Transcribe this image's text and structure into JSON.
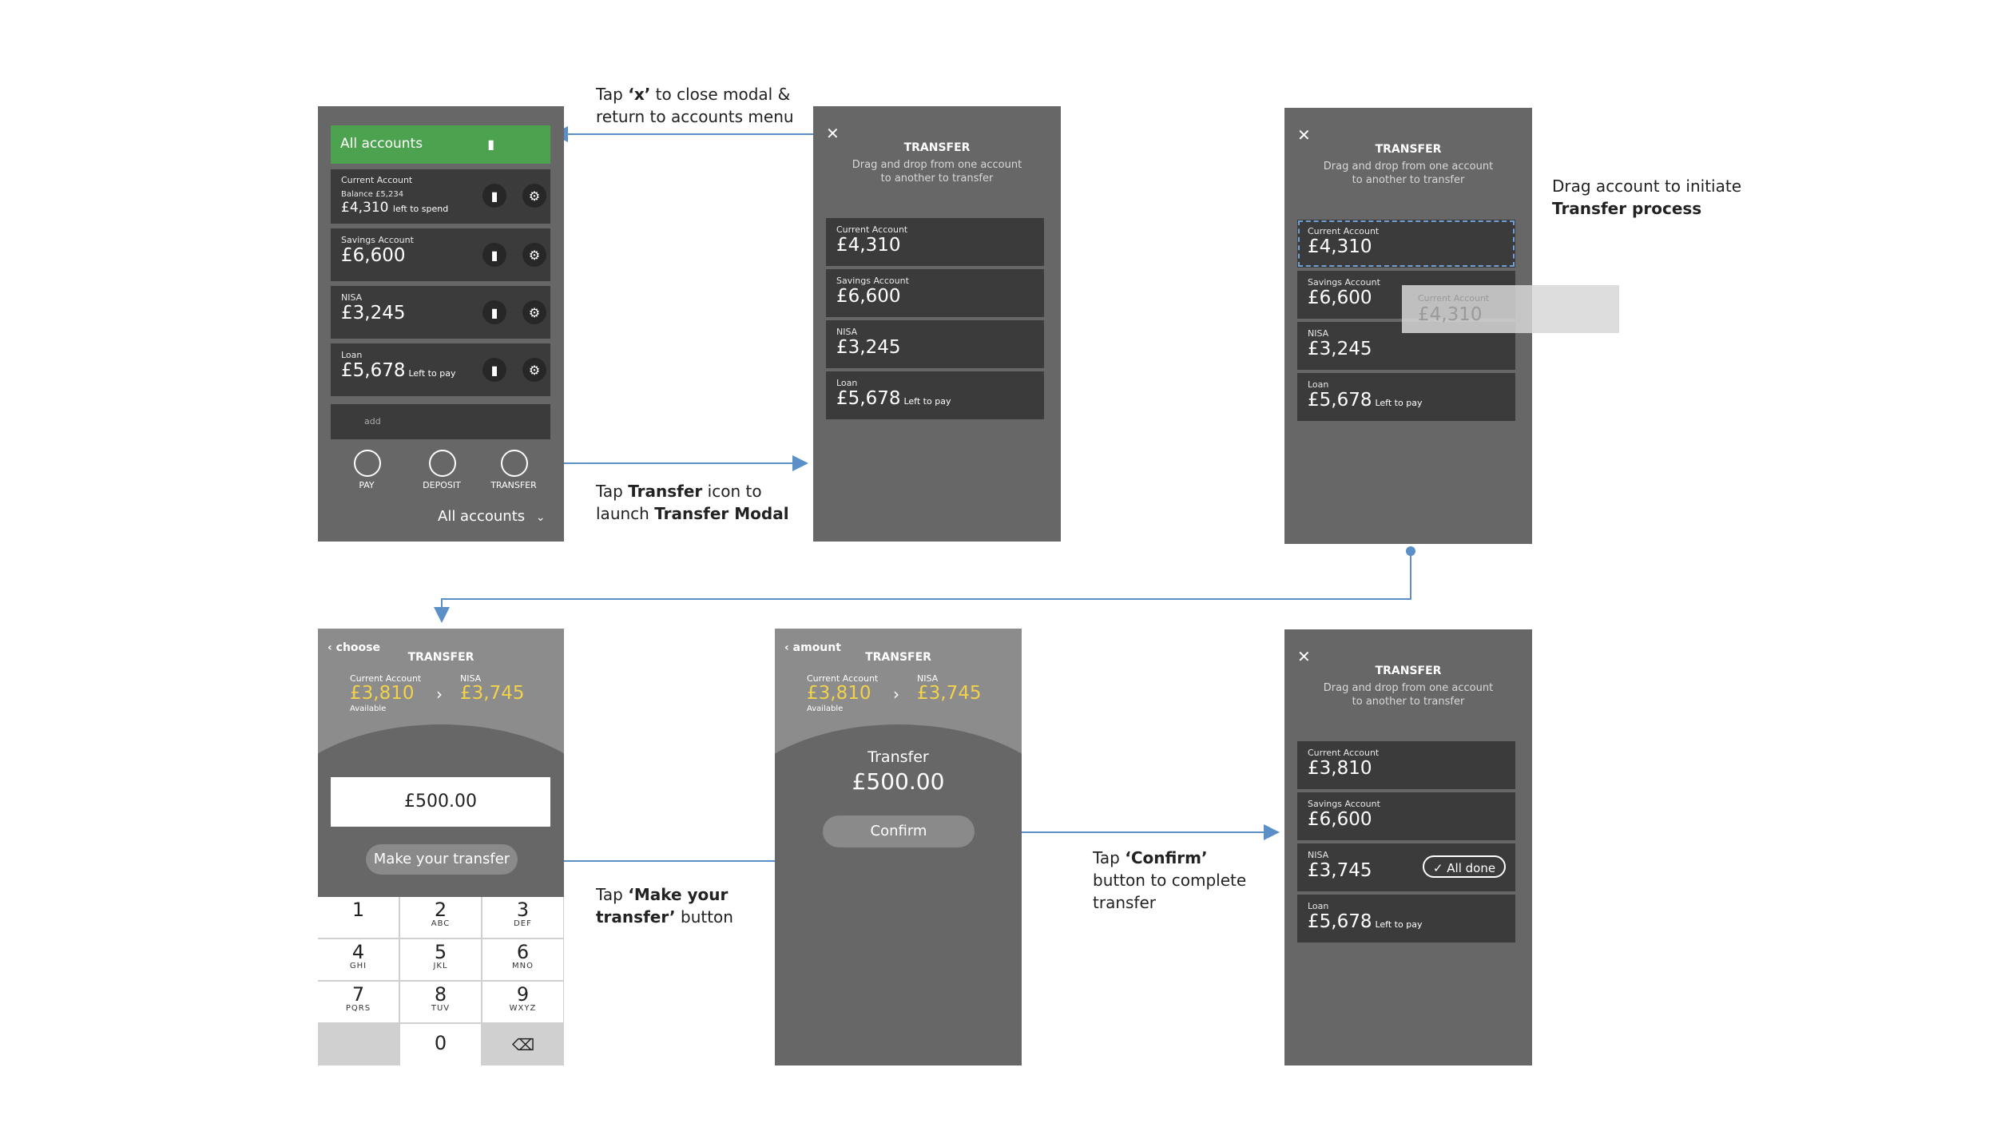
{
  "colors": {
    "screen": "#676767",
    "row": "#3b3b3b",
    "green": "#4da24f",
    "yellow": "#f2d24b",
    "connector": "#5a8fc7"
  },
  "screen1": {
    "header": "All accounts",
    "current": {
      "name": "Current Account",
      "balance": "Balance £5,234",
      "amount": "£4,310",
      "suffix": "left to spend"
    },
    "savings": {
      "name": "Savings Account",
      "amount": "£6,600"
    },
    "nisa": {
      "name": "NISA",
      "amount": "£3,245"
    },
    "loan": {
      "name": "Loan",
      "amount": "£5,678",
      "suffix": "Left to pay"
    },
    "add": "add",
    "actions": [
      "PAY",
      "DEPOSIT",
      "TRANSFER"
    ],
    "footer": "All accounts"
  },
  "transfer_modal": {
    "title": "TRANSFER",
    "subtitle_line1": "Drag and drop from one account",
    "subtitle_line2": "to another to transfer",
    "accounts": [
      {
        "name": "Current Account",
        "amount": "£4,310",
        "suffix": ""
      },
      {
        "name": "Savings Account",
        "amount": "£6,600",
        "suffix": ""
      },
      {
        "name": "NISA",
        "amount": "£3,245",
        "suffix": ""
      },
      {
        "name": "Loan",
        "amount": "£5,678",
        "suffix": "Left to pay"
      }
    ]
  },
  "drag_ghost": {
    "name": "Current Account",
    "amount": "£4,310"
  },
  "choose_screen": {
    "back": "choose",
    "title": "TRANSFER",
    "from_name": "Current Account",
    "from_amount": "£3,810",
    "from_note": "Available",
    "to_name": "NISA",
    "to_amount": "£3,745",
    "input_value": "£500.00",
    "button": "Make your transfer",
    "keys": [
      {
        "n": "1",
        "l": ""
      },
      {
        "n": "2",
        "l": "ABC"
      },
      {
        "n": "3",
        "l": "DEF"
      },
      {
        "n": "4",
        "l": "GHI"
      },
      {
        "n": "5",
        "l": "JKL"
      },
      {
        "n": "6",
        "l": "MNO"
      },
      {
        "n": "7",
        "l": "PQRS"
      },
      {
        "n": "8",
        "l": "TUV"
      },
      {
        "n": "9",
        "l": "WXYZ"
      },
      {
        "n": "0",
        "l": ""
      }
    ]
  },
  "amount_screen": {
    "back": "amount",
    "title": "TRANSFER",
    "from_name": "Current Account",
    "from_amount": "£3,810",
    "from_note": "Available",
    "to_name": "NISA",
    "to_amount": "£3,745",
    "label": "Transfer",
    "value": "£500.00",
    "button": "Confirm"
  },
  "done_screen": {
    "title": "TRANSFER",
    "subtitle_line1": "Drag and drop from one account",
    "subtitle_line2": "to another to transfer",
    "accounts": [
      {
        "name": "Current Account",
        "amount": "£3,810",
        "suffix": ""
      },
      {
        "name": "Savings Account",
        "amount": "£6,600",
        "suffix": ""
      },
      {
        "name": "NISA",
        "amount": "£3,745",
        "suffix": ""
      },
      {
        "name": "Loan",
        "amount": "£5,678",
        "suffix": "Left to pay"
      }
    ],
    "badge": "All done"
  },
  "notes": {
    "close": {
      "a": "Tap ",
      "b": "‘x’",
      "c": " to close modal &",
      "d": "return to accounts menu"
    },
    "transfer": {
      "a": "Tap ",
      "b": "Transfer",
      "c": " icon to",
      "d": "launch ",
      "e": "Transfer Modal"
    },
    "drag": {
      "a": "Drag account to initiate",
      "b": "Transfer process"
    },
    "make": {
      "a": "Tap ",
      "b": "‘Make your",
      "c": "transfer’",
      "d": " button"
    },
    "confirm": {
      "a": "Tap ",
      "b": "‘Confirm’",
      "c": "button to complete",
      "d": "transfer"
    }
  }
}
